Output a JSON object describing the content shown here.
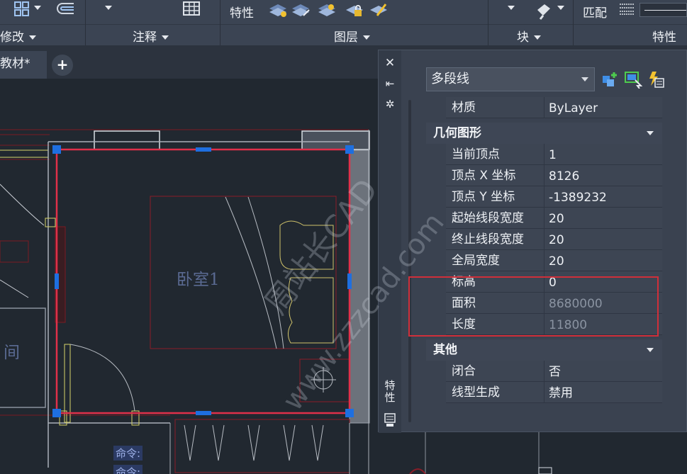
{
  "ribbon": {
    "panels": [
      {
        "label": "修改"
      },
      {
        "label": "注释"
      },
      {
        "label": "图层"
      },
      {
        "label": "块"
      },
      {
        "label": "特性"
      }
    ],
    "top_labels": {
      "properties": "特性",
      "match": "匹配"
    }
  },
  "tabs": {
    "document": "教材*",
    "add": "+"
  },
  "canvas": {
    "room_label": "卧室1",
    "room_partial": "间",
    "command_lines": [
      "命令:",
      "命令:"
    ]
  },
  "palette": {
    "title_vertical": "特性",
    "object_type": "多段线",
    "top_row": {
      "label": "材质",
      "value": "ByLayer"
    },
    "sections": [
      {
        "title": "几何图形",
        "rows": [
          {
            "label": "当前顶点",
            "value": "1",
            "readonly": false
          },
          {
            "label": "顶点 X 坐标",
            "value": "8126",
            "readonly": false
          },
          {
            "label": "顶点 Y 坐标",
            "value": "-1389232",
            "readonly": false
          },
          {
            "label": "起始线段宽度",
            "value": "20",
            "readonly": false
          },
          {
            "label": "终止线段宽度",
            "value": "20",
            "readonly": false
          },
          {
            "label": "全局宽度",
            "value": "20",
            "readonly": false
          },
          {
            "label": "标高",
            "value": "0",
            "readonly": false
          },
          {
            "label": "面积",
            "value": "8680000",
            "readonly": true
          },
          {
            "label": "长度",
            "value": "11800",
            "readonly": true
          }
        ]
      },
      {
        "title": "其他",
        "rows": [
          {
            "label": "闭合",
            "value": "否",
            "readonly": false
          },
          {
            "label": "线型生成",
            "value": "禁用",
            "readonly": false
          }
        ]
      }
    ]
  },
  "watermark": {
    "line1": "周站长CAD",
    "line2": "www.zzzcad.com"
  },
  "colors": {
    "highlight": "#d02f3a",
    "grip": "#1e6fe0",
    "polyline": "#e0304a"
  }
}
